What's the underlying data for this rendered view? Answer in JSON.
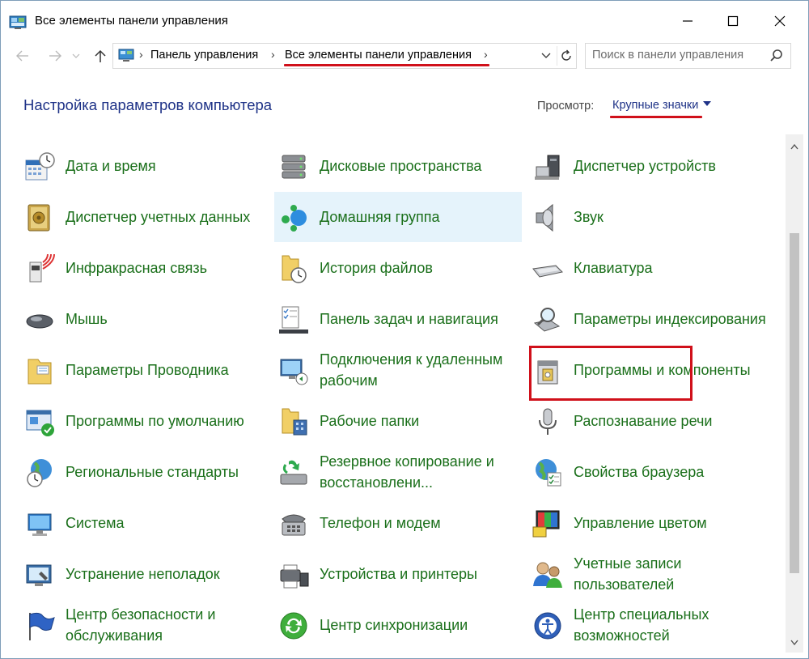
{
  "window": {
    "title": "Все элементы панели управления"
  },
  "address": {
    "crumbs": [
      "Панель управления",
      "Все элементы панели управления"
    ]
  },
  "search": {
    "placeholder": "Поиск в панели управления"
  },
  "header": {
    "title": "Настройка параметров компьютера",
    "view_label": "Просмотр:",
    "view_value": "Крупные значки"
  },
  "columns": [
    [
      {
        "label": "Дата и время",
        "icon": "date-time-icon"
      },
      {
        "label": "Диспетчер учетных данных",
        "icon": "credential-manager-icon"
      },
      {
        "label": "Инфракрасная связь",
        "icon": "infrared-icon"
      },
      {
        "label": "Мышь",
        "icon": "mouse-icon"
      },
      {
        "label": "Параметры Проводника",
        "icon": "explorer-options-icon"
      },
      {
        "label": "Программы по умолчанию",
        "icon": "default-programs-icon"
      },
      {
        "label": "Региональные стандарты",
        "icon": "region-icon"
      },
      {
        "label": "Система",
        "icon": "system-icon"
      },
      {
        "label": "Устранение неполадок",
        "icon": "troubleshooting-icon"
      },
      {
        "label": "Центр безопасности и обслуживания",
        "icon": "security-center-flag-icon"
      }
    ],
    [
      {
        "label": "Дисковые пространства",
        "icon": "storage-spaces-icon"
      },
      {
        "label": "Домашняя группа",
        "icon": "homegroup-icon"
      },
      {
        "label": "История файлов",
        "icon": "file-history-icon"
      },
      {
        "label": "Панель задач и навигация",
        "icon": "taskbar-icon"
      },
      {
        "label": "Подключения к удаленным рабочим",
        "icon": "remote-connections-icon"
      },
      {
        "label": "Рабочие папки",
        "icon": "work-folders-icon"
      },
      {
        "label": "Резервное копирование и восстановлени...",
        "icon": "backup-restore-icon"
      },
      {
        "label": "Телефон и модем",
        "icon": "phone-modem-icon"
      },
      {
        "label": "Устройства и принтеры",
        "icon": "devices-printers-icon"
      },
      {
        "label": "Центр синхронизации",
        "icon": "sync-center-icon"
      }
    ],
    [
      {
        "label": "Диспетчер устройств",
        "icon": "device-manager-icon"
      },
      {
        "label": "Звук",
        "icon": "sound-icon"
      },
      {
        "label": "Клавиатура",
        "icon": "keyboard-icon"
      },
      {
        "label": "Параметры индексирования",
        "icon": "indexing-options-icon"
      },
      {
        "label": "Программы и компоненты",
        "icon": "programs-features-icon"
      },
      {
        "label": "Распознавание речи",
        "icon": "speech-recognition-icon"
      },
      {
        "label": "Свойства браузера",
        "icon": "internet-options-icon"
      },
      {
        "label": "Управление цветом",
        "icon": "color-management-icon"
      },
      {
        "label": "Учетные записи пользователей",
        "icon": "user-accounts-icon"
      },
      {
        "label": "Центр специальных возможностей",
        "icon": "ease-of-access-icon"
      }
    ]
  ],
  "colors": {
    "link_green": "#1a6f1a",
    "heading_blue": "#1e3287",
    "annotation_red": "#d0101a",
    "hover_bg": "#e5f3fb"
  }
}
